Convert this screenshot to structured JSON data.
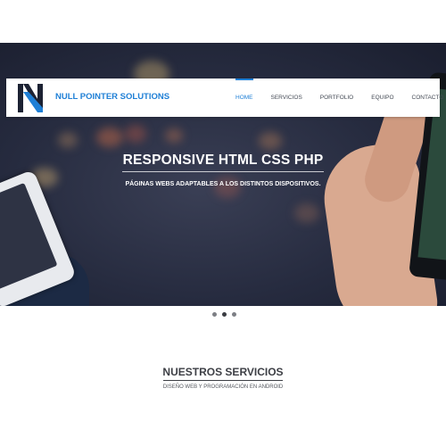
{
  "brand": {
    "name": "NULL POINTER SOLUTIONS",
    "color": "#1e7fd6"
  },
  "nav": {
    "items": [
      {
        "label": "HOME",
        "active": true
      },
      {
        "label": "SERVICIOS",
        "active": false
      },
      {
        "label": "PORTFOLIO",
        "active": false
      },
      {
        "label": "EQUIPO",
        "active": false
      },
      {
        "label": "CONTACTO",
        "active": false
      }
    ]
  },
  "hero": {
    "title": "RESPONSIVE HTML CSS PHP",
    "subtitle": "PÁGINAS WEBS ADAPTABLES A LOS DISTINTOS DISPOSITIVOS."
  },
  "carousel": {
    "slide_count": 3,
    "active_index": 1
  },
  "services": {
    "title": "NUESTROS SERVICIOS",
    "subtitle": "DISEÑO WEB Y PROGRAMACIÓN EN ANDROID"
  }
}
